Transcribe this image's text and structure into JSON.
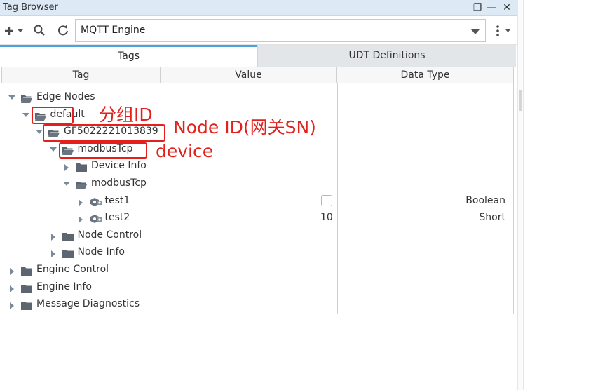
{
  "window": {
    "title": "Tag Browser",
    "buttons": {
      "restore": "❐",
      "minimize": "—",
      "close": "✕"
    }
  },
  "toolbar": {
    "add_icon": "plus-icon",
    "search_icon": "search-icon",
    "refresh_icon": "refresh-icon",
    "more_icon": "more-vertical-icon",
    "provider": "MQTT Engine"
  },
  "tabs": [
    {
      "label": "Tags",
      "active": true
    },
    {
      "label": "UDT Definitions",
      "active": false
    }
  ],
  "columns": {
    "tag": "Tag",
    "value": "Value",
    "data_type": "Data Type"
  },
  "tree": [
    {
      "label": "Edge Nodes",
      "level": 0,
      "expanded": true,
      "type": "folder-open"
    },
    {
      "label": "default",
      "level": 1,
      "expanded": true,
      "type": "folder-open"
    },
    {
      "label": "GF5022221013839",
      "level": 2,
      "expanded": true,
      "type": "folder-open"
    },
    {
      "label": "modbusTcp",
      "level": 3,
      "expanded": true,
      "type": "folder-open"
    },
    {
      "label": "Device Info",
      "level": 4,
      "expanded": false,
      "type": "folder"
    },
    {
      "label": "modbusTcp",
      "level": 4,
      "expanded": true,
      "type": "folder-open"
    },
    {
      "label": "test1",
      "level": 5,
      "expanded": false,
      "type": "tag",
      "value_checkbox": true,
      "data_type": "Boolean"
    },
    {
      "label": "test2",
      "level": 5,
      "expanded": false,
      "type": "tag",
      "value": "10",
      "data_type": "Short"
    },
    {
      "label": "Node Control",
      "level": 3,
      "expanded": false,
      "type": "folder"
    },
    {
      "label": "Node Info",
      "level": 3,
      "expanded": false,
      "type": "folder"
    },
    {
      "label": "Engine Control",
      "level": 0,
      "expanded": false,
      "type": "folder"
    },
    {
      "label": "Engine Info",
      "level": 0,
      "expanded": false,
      "type": "folder"
    },
    {
      "label": "Message Diagnostics",
      "level": 0,
      "expanded": false,
      "type": "folder"
    }
  ],
  "annotations": {
    "group_id": "分组ID",
    "node_id": "Node ID(网关SN)",
    "device": "device"
  },
  "colors": {
    "annotation": "#e3201b",
    "titlebar": "#dde9f5",
    "tab_accent": "#4aa3df",
    "folder": "#5d6670"
  }
}
